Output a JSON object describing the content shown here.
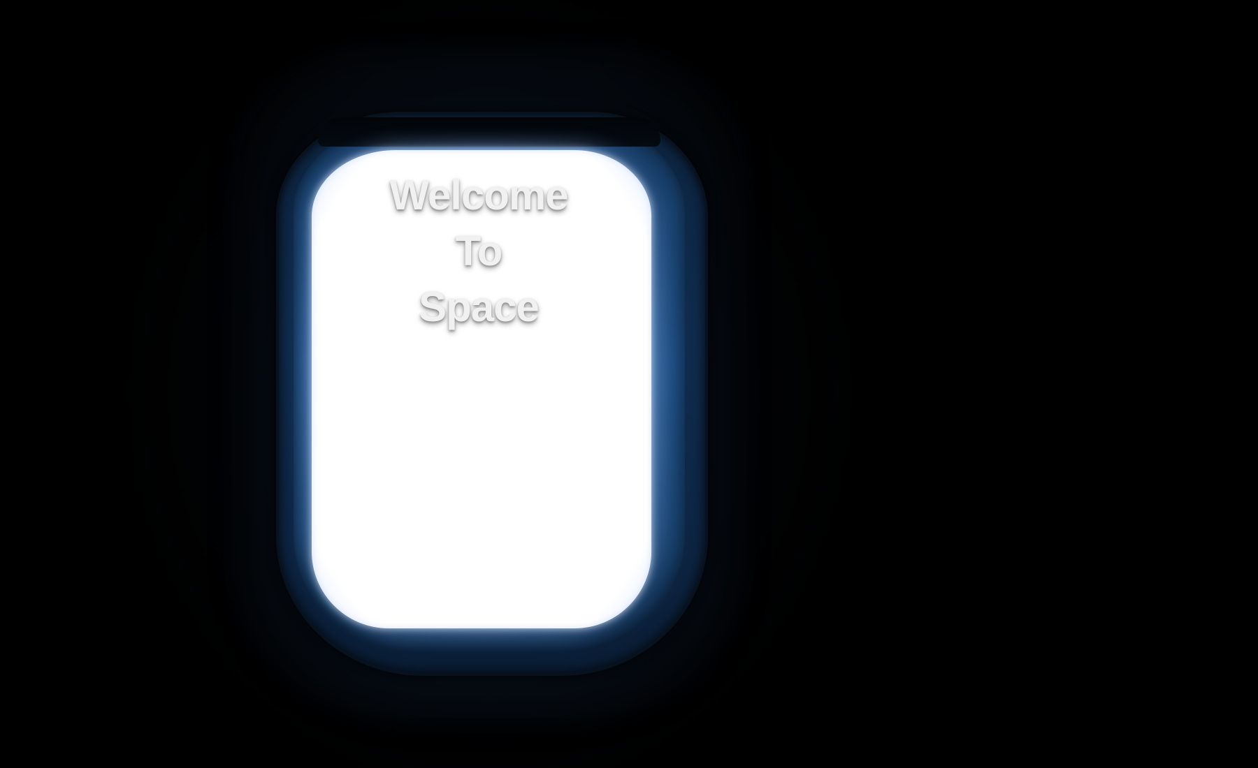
{
  "headline": {
    "line1": "Welcome",
    "line2": "To",
    "line3": "Space"
  },
  "colors": {
    "background": "#000000",
    "window_frame": "#1c4c80",
    "glass": "#ffffff",
    "text": "#f1f1f1"
  }
}
